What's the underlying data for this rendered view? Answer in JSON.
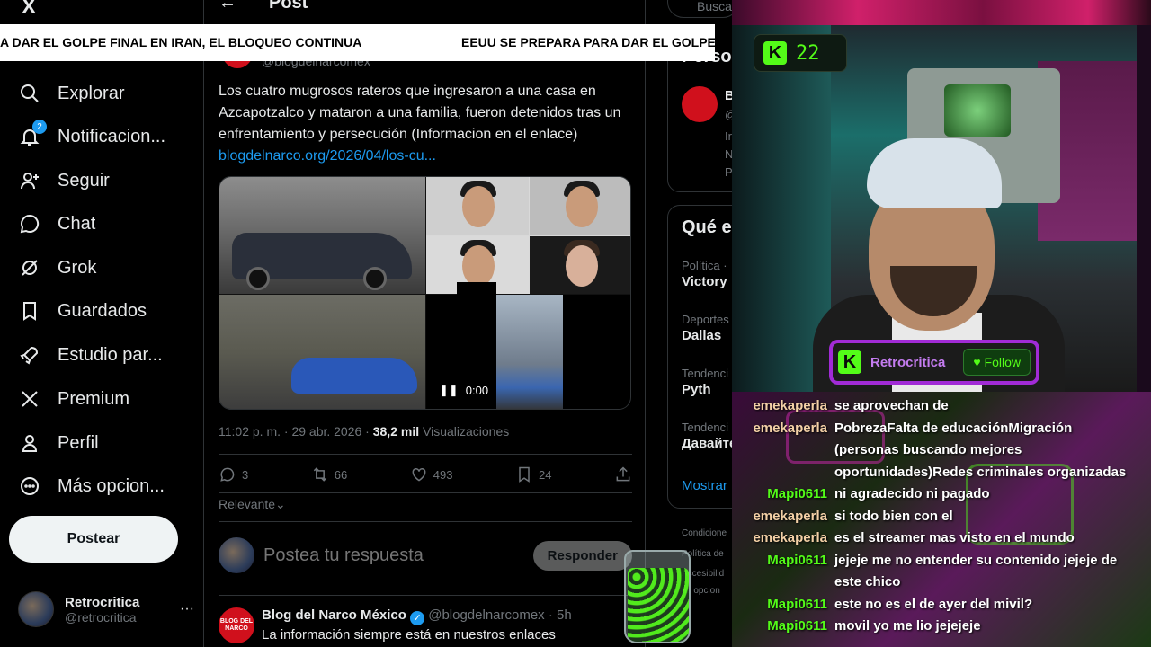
{
  "ticker": {
    "text_left": "A DAR EL GOLPE FINAL EN IRAN, EL BLOQUEO CONTINUA",
    "text_right": "EEUU SE PREPARA PARA DAR EL GOLPE"
  },
  "sidebar": {
    "logo": "X",
    "items": [
      {
        "label": "Explorar",
        "icon": "search-icon"
      },
      {
        "label": "Notificacion...",
        "icon": "bell-icon",
        "badge": "2"
      },
      {
        "label": "Seguir",
        "icon": "add-person-icon"
      },
      {
        "label": "Chat",
        "icon": "chat-bubble-icon"
      },
      {
        "label": "Grok",
        "icon": "grok-icon"
      },
      {
        "label": "Guardados",
        "icon": "bookmark-icon"
      },
      {
        "label": "Estudio par...",
        "icon": "rocket-icon"
      },
      {
        "label": "Premium",
        "icon": "x-icon"
      },
      {
        "label": "Perfil",
        "icon": "person-icon"
      },
      {
        "label": "Más opcion...",
        "icon": "more-circle-icon"
      }
    ],
    "post_button": "Postear",
    "profile": {
      "name": "Retrocritica",
      "handle": "@retrocritica",
      "more": "···"
    }
  },
  "main": {
    "back_arrow": "←",
    "header_title": "Post",
    "author_handle_top": "@blogdelnarcomex",
    "tweet_text": "Los cuatro mugrosos rateros que ingresaron a una casa en Azcapotzalco y mataron a una familia, fueron detenidos tras un enfrentamiento y persecución (Informacion en el enlace)",
    "tweet_link": "blogdelnarco.org/2026/04/los-cu...",
    "video_time": "0:00",
    "meta": {
      "time": "11:02 p. m. · 29 abr. 2026 · ",
      "views_count": "38,2 mil",
      "views_label": " Visualizaciones"
    },
    "actions": {
      "replies": "3",
      "reposts": "66",
      "likes": "493",
      "bookmarks": "24"
    },
    "sort_label": "Relevante",
    "reply_placeholder": "Postea tu respuesta",
    "reply_button": "Responder",
    "reply_tweet": {
      "avatar_text": "BLOG DEL NARCO",
      "name": "Blog del Narco México",
      "handle": "@blogdelnarcomex",
      "time": "· 5h",
      "text": "La información siempre está en nuestros enlaces"
    }
  },
  "right": {
    "search_placeholder": "Busca",
    "persons_title": "Perso",
    "person_name": "B",
    "person_lines": [
      "@",
      "Ir",
      "N",
      "P"
    ],
    "trends_title": "Qué e",
    "trends": [
      {
        "category": "Política ·",
        "name": "Victory"
      },
      {
        "category": "Deportes",
        "name": "Dallas"
      },
      {
        "category": "Tendenci",
        "name": "Pyth"
      },
      {
        "category": "Tendenci",
        "name": "Давайте"
      }
    ],
    "show_more": "Mostrar",
    "footer": [
      "Condicione",
      "Política de",
      "Accesibilid",
      "ás opcion"
    ]
  },
  "stream": {
    "kick_count": "22",
    "channel": "Retrocritica",
    "follow": "Follow",
    "chat": [
      {
        "user": "emekaperla",
        "msg": "se aprovechan de"
      },
      {
        "user": "emekaperla",
        "msg": "PobrezaFalta de educaciónMigración (personas buscando mejores oportunidades)Redes criminales organizadas"
      },
      {
        "user": "Mapi0611",
        "msg": "ni agradecido ni pagado"
      },
      {
        "user": "emekaperla",
        "msg": "si todo bien con el"
      },
      {
        "user": "emekaperla",
        "msg": "es el streamer mas visto en el mundo"
      },
      {
        "user": "Mapi0611",
        "msg": "jejeje me no entender su contenido jejeje de este chico"
      },
      {
        "user": "Mapi0611",
        "msg": "este no es el de ayer del mivil?"
      },
      {
        "user": "Mapi0611",
        "msg": "movil yo me lio jejejeje"
      }
    ]
  }
}
